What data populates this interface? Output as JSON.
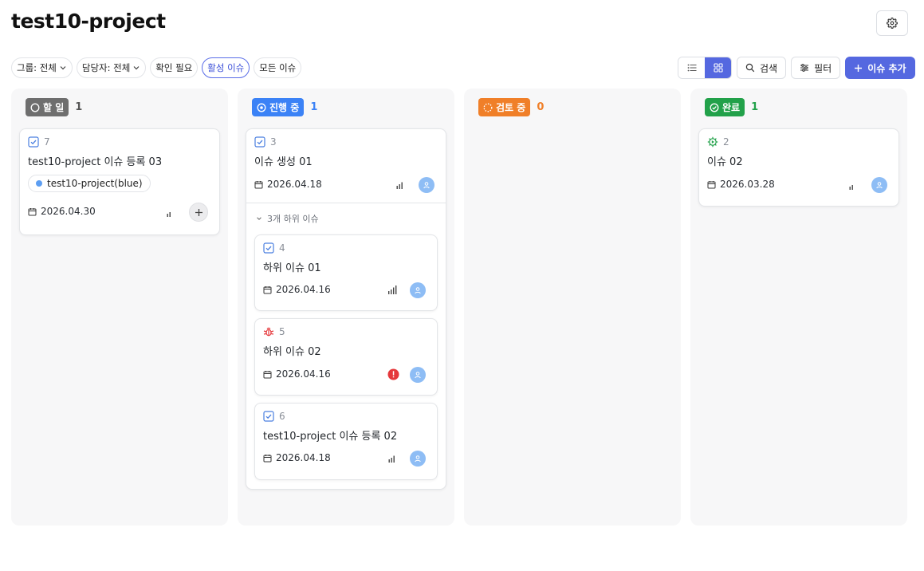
{
  "header": {
    "title": "test10-project"
  },
  "filters": {
    "group": "그룹: 전체",
    "assignee": "담당자: 전체",
    "needs_check": "확인 필요",
    "active_issues": "활성 이슈",
    "all_issues": "모든 이슈"
  },
  "toolbar": {
    "search": "검색",
    "filter": "필터",
    "add_issue": "이슈 추가"
  },
  "colors": {
    "accent": "#5568e0",
    "todo": "#6e6e6e",
    "in_progress": "#3b82f6",
    "review": "#f07f28",
    "done": "#22a14a",
    "urgent": "#e5383b",
    "avatar": "#8ebdf5"
  },
  "columns": [
    {
      "status": "할 일",
      "count": "1",
      "cards": [
        {
          "type_icon": "checkbox-icon",
          "number": "7",
          "title": "test10-project 이슈 등록 03",
          "tag": "test10-project(blue)",
          "date": "2026.04.30",
          "priority_icon": "priority-low-icon"
        }
      ]
    },
    {
      "status": "진행 중",
      "count": "1",
      "cards": [
        {
          "type_icon": "checkbox-icon",
          "number": "3",
          "title": "이슈 생성 01",
          "date": "2026.04.18",
          "priority_icon": "priority-medium-icon",
          "subissue_label": "3개 하위 이슈",
          "subissues": [
            {
              "type_icon": "checkbox-icon",
              "number": "4",
              "title": "하위 이슈 01",
              "date": "2026.04.16",
              "priority_icon": "priority-high-icon"
            },
            {
              "type_icon": "bug-icon",
              "number": "5",
              "title": "하위 이슈 02",
              "date": "2026.04.16",
              "priority_icon": "urgent-icon"
            },
            {
              "type_icon": "checkbox-icon",
              "number": "6",
              "title": "test10-project 이슈 등록 02",
              "date": "2026.04.18",
              "priority_icon": "priority-medium-icon"
            }
          ]
        }
      ]
    },
    {
      "status": "검토 중",
      "count": "0",
      "cards": []
    },
    {
      "status": "완료",
      "count": "1",
      "cards": [
        {
          "type_icon": "gear-play-icon",
          "number": "2",
          "title": "이슈 02",
          "date": "2026.03.28",
          "priority_icon": "priority-low-icon"
        }
      ]
    }
  ]
}
